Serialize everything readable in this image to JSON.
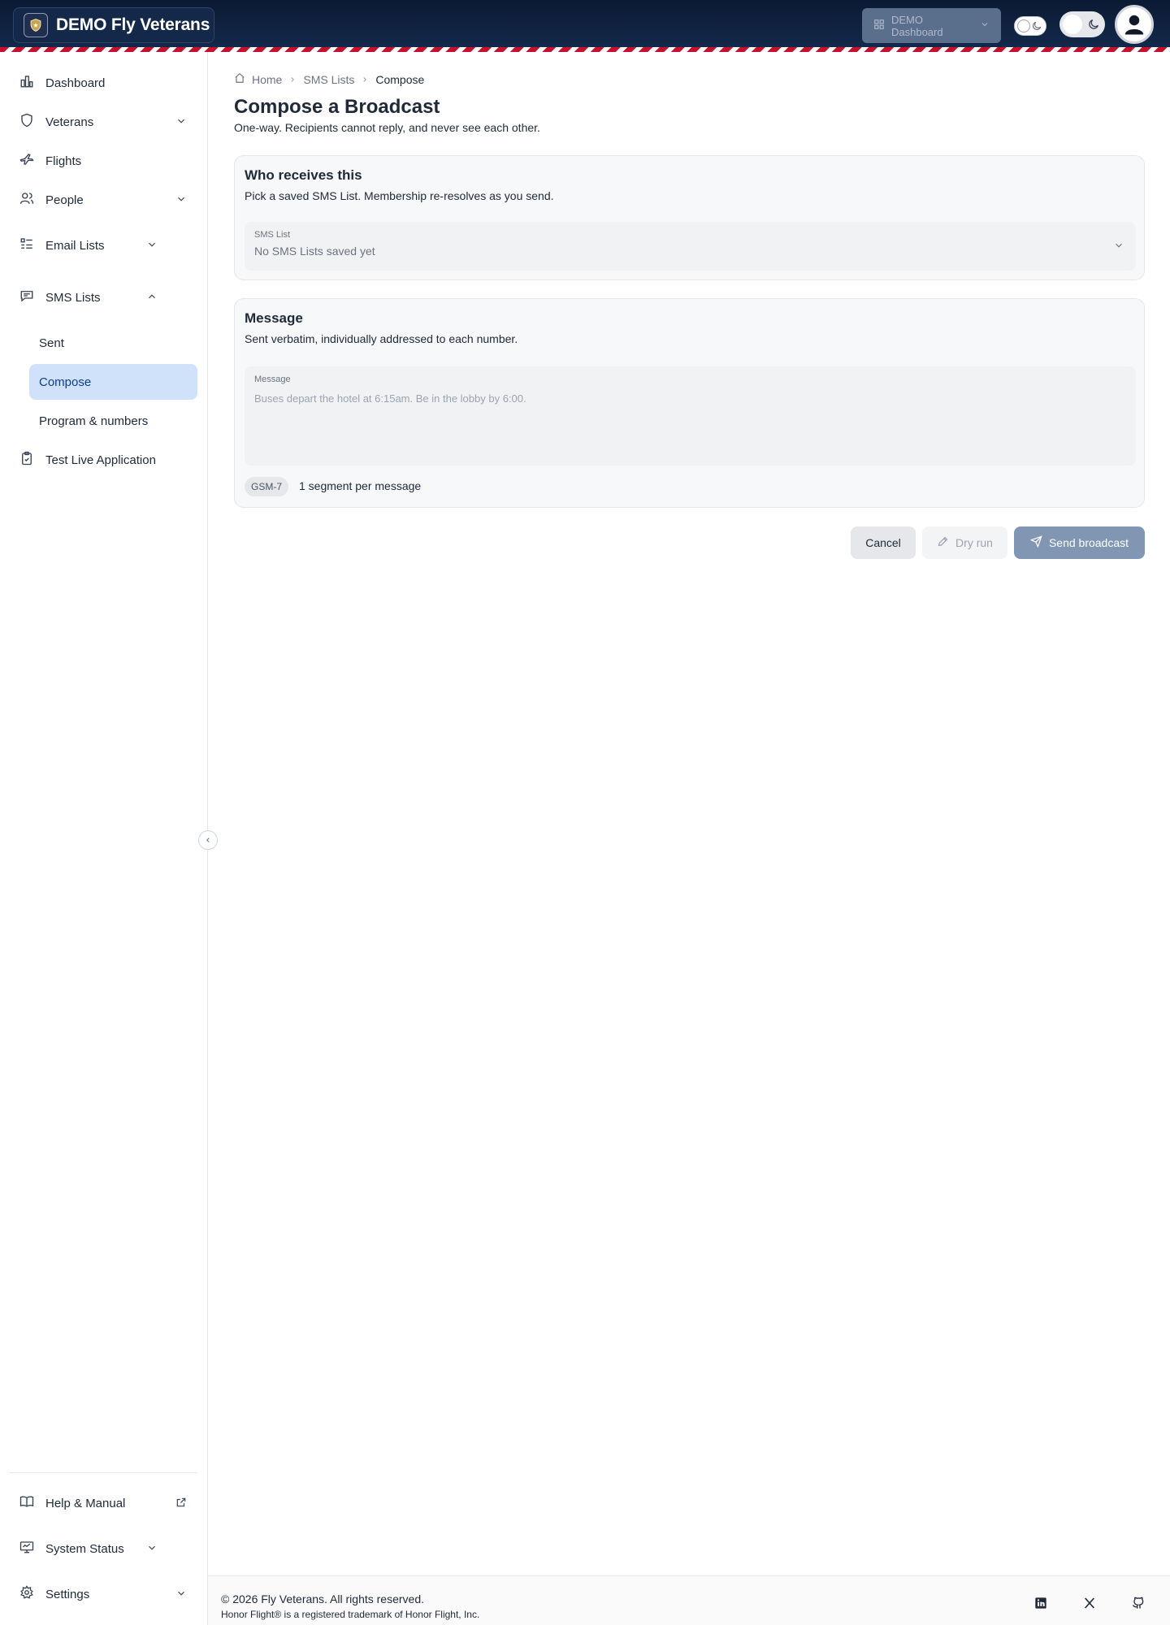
{
  "header": {
    "brand_title": "DEMO Fly Veterans",
    "dashboard_select": "DEMO Dashboard"
  },
  "sidebar": {
    "items": [
      {
        "label": "Dashboard",
        "icon": "chart-icon"
      },
      {
        "label": "Veterans",
        "icon": "shield-icon"
      },
      {
        "label": "Flights",
        "icon": "plane-icon"
      },
      {
        "label": "People",
        "icon": "people-icon"
      },
      {
        "label": "Email Lists",
        "icon": "list-icon"
      },
      {
        "label": "SMS Lists",
        "icon": "message-icon"
      },
      {
        "label": "Test Live Application",
        "icon": "clipboard-icon"
      }
    ],
    "sms_sub_items": [
      "Sent",
      "Compose",
      "Program & numbers"
    ],
    "active_sub_item": "Compose",
    "bottom_items": [
      {
        "label": "Help & Manual",
        "icon": "book-icon"
      },
      {
        "label": "System Status",
        "icon": "monitor-icon"
      },
      {
        "label": "Settings",
        "icon": "gear-icon"
      }
    ]
  },
  "breadcrumb": [
    "Home",
    "SMS Lists",
    "Compose"
  ],
  "page": {
    "title": "Compose a Broadcast",
    "subtitle": "One-way. Recipients cannot reply, and never see each other."
  },
  "recipients_card": {
    "title": "Who receives this",
    "subtitle": "Pick a saved SMS List. Membership re-resolves as you send.",
    "field_label": "SMS List",
    "field_value": "No SMS Lists saved yet"
  },
  "message_card": {
    "title": "Message",
    "subtitle": "Sent verbatim, individually addressed to each number.",
    "field_label": "Message",
    "placeholder": "Buses depart the hotel at 6:15am. Be in the lobby by 6:00.",
    "encoding_badge": "GSM-7",
    "segments_text": "1 segment per message"
  },
  "actions": {
    "cancel": "Cancel",
    "dry_run": "Dry run",
    "send": "Send broadcast"
  },
  "footer": {
    "copyright": "© 2026 Fly Veterans. All rights reserved.",
    "trademark": "Honor Flight® is a registered trademark of Honor Flight, Inc."
  },
  "colors": {
    "header_bg": "#0b1a33",
    "stripe_red": "#c8102e",
    "active_nav_bg": "#cfe2fa",
    "send_button_bg": "#8096b3"
  }
}
